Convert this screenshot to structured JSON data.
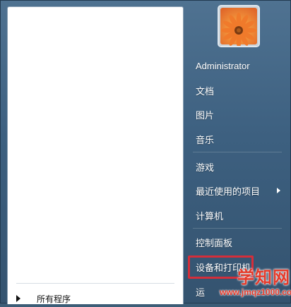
{
  "start_menu": {
    "all_programs_label": "所有程序",
    "user_name": "Administrator",
    "right_items": [
      {
        "label": "文档"
      },
      {
        "label": "图片"
      },
      {
        "label": "音乐"
      },
      {
        "label": "游戏"
      },
      {
        "label": "最近使用的项目",
        "has_submenu": true
      },
      {
        "label": "计算机"
      },
      {
        "label": "控制面板"
      },
      {
        "label": "设备和打印机"
      },
      {
        "label": "运"
      }
    ],
    "highlighted_item": "设备和打印机"
  },
  "watermark": {
    "title": "学知网",
    "url": "www.jmqz1000.com"
  },
  "colors": {
    "highlight_border": "#d42e3a",
    "watermark": "#e53a2a"
  }
}
